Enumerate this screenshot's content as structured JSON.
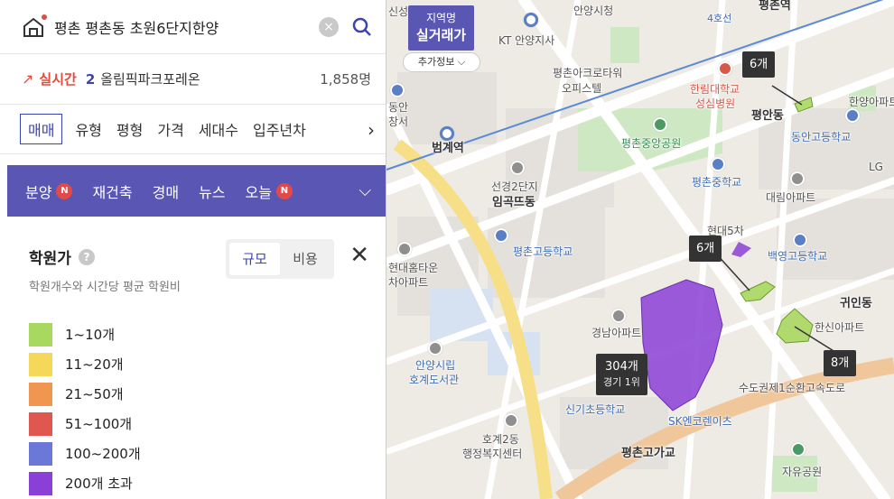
{
  "search": {
    "query": "평촌 평촌동 초원6단지한양"
  },
  "trending": {
    "label": "실시간",
    "rank": "2",
    "name": "올림픽파크포레온",
    "count": "1,858명"
  },
  "filters": {
    "items": [
      "매매",
      "유형",
      "평형",
      "가격",
      "세대수",
      "입주년차"
    ]
  },
  "menu": {
    "items": [
      {
        "label": "분양",
        "badge": "N"
      },
      {
        "label": "재건축",
        "badge": ""
      },
      {
        "label": "경매",
        "badge": ""
      },
      {
        "label": "뉴스",
        "badge": ""
      },
      {
        "label": "오늘",
        "badge": "N"
      }
    ]
  },
  "academy": {
    "title": "학원가",
    "subtitle": "학원개수와 시간당 평균 학원비",
    "seg_scale": "규모",
    "seg_cost": "비용",
    "legend": [
      {
        "label": "1~10개",
        "color": "#a8d85f"
      },
      {
        "label": "11~20개",
        "color": "#f5d75a"
      },
      {
        "label": "21~50개",
        "color": "#f09650"
      },
      {
        "label": "51~100개",
        "color": "#e0574f"
      },
      {
        "label": "100~200개",
        "color": "#6c78d8"
      },
      {
        "label": "200개 초과",
        "color": "#8a3fd6"
      }
    ]
  },
  "map": {
    "toggle_top": "지역명",
    "toggle_main": "실거래가",
    "more_info": "추가정보",
    "labels": {
      "l1": "안양시청",
      "l2": "KT 안양지사",
      "l3": "평촌아크로타워",
      "l3b": "오피스텔",
      "l4": "한림대학교",
      "l4b": "성심병원",
      "l5": "평안동",
      "l6": "동안고등학교",
      "l7": "평촌중앙공원",
      "l8": "범계역",
      "l9": "선경2단지",
      "l9b": "임곡뜨동",
      "l10": "평촌중학교",
      "l11": "대림아파트",
      "l12": "현대5차",
      "l13": "평촌고등학교",
      "l14": "백영고등학교",
      "l15": "현대홈타운",
      "l15b": "차아파트",
      "l16": "귀인동",
      "l17": "한신아파트",
      "l18": "경남아파트",
      "l19": "안양시립",
      "l19b": "호계도서관",
      "l20": "수도권제1순환고속도로",
      "l21": "신기초등학교",
      "l22": "SK엔코렌이츠",
      "l23": "호계2동",
      "l23b": "행정복지센터",
      "l24": "평촌고가교",
      "l25": "자유공원",
      "l26": "평촌역",
      "l27": "4호선",
      "l28": "한양아파트",
      "l29": "LG",
      "l30": "신성",
      "l31": "동안",
      "l32": "창서"
    },
    "tooltips": {
      "t1": "6개",
      "t2": "6개",
      "t3": "304개",
      "t3_sub": "경기 1위",
      "t4": "8개"
    }
  }
}
